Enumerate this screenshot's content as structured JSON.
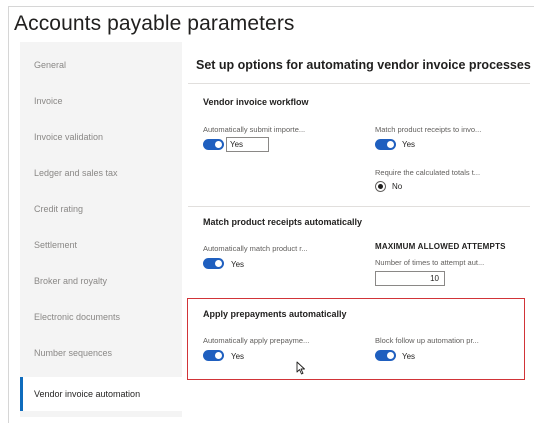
{
  "page": {
    "title": "Accounts payable parameters"
  },
  "nav": {
    "items": [
      {
        "label": "General"
      },
      {
        "label": "Invoice"
      },
      {
        "label": "Invoice validation"
      },
      {
        "label": "Ledger and sales tax"
      },
      {
        "label": "Credit rating"
      },
      {
        "label": "Settlement"
      },
      {
        "label": "Broker and royalty"
      },
      {
        "label": "Electronic documents"
      },
      {
        "label": "Number sequences"
      },
      {
        "label": "Vendor invoice automation"
      }
    ],
    "selected_index": 9
  },
  "content": {
    "title": "Set up options for automating vendor invoice processes",
    "sections": {
      "workflow": {
        "title": "Vendor invoice workflow",
        "auto_submit": {
          "label": "Automatically submit importe...",
          "value": "Yes"
        },
        "match_receipts": {
          "label": "Match product receipts to invo...",
          "value": "Yes"
        },
        "require_totals": {
          "label": "Require the calculated totals t...",
          "value": "No"
        }
      },
      "match": {
        "title": "Match product receipts automatically",
        "auto_match": {
          "label": "Automatically match product r...",
          "value": "Yes"
        },
        "max_attempts_heading": "MAXIMUM ALLOWED ATTEMPTS",
        "attempts": {
          "label": "Number of times to attempt aut...",
          "value": "10"
        }
      },
      "prepayments": {
        "title": "Apply prepayments automatically",
        "auto_apply": {
          "label": "Automatically apply prepayme...",
          "value": "Yes"
        },
        "block_followup": {
          "label": "Block follow up automation pr...",
          "value": "Yes"
        }
      }
    }
  },
  "colors": {
    "toggle_on": "#1f5fbf",
    "highlight_border": "#d13438",
    "nav_bg": "#f4f4f4"
  }
}
